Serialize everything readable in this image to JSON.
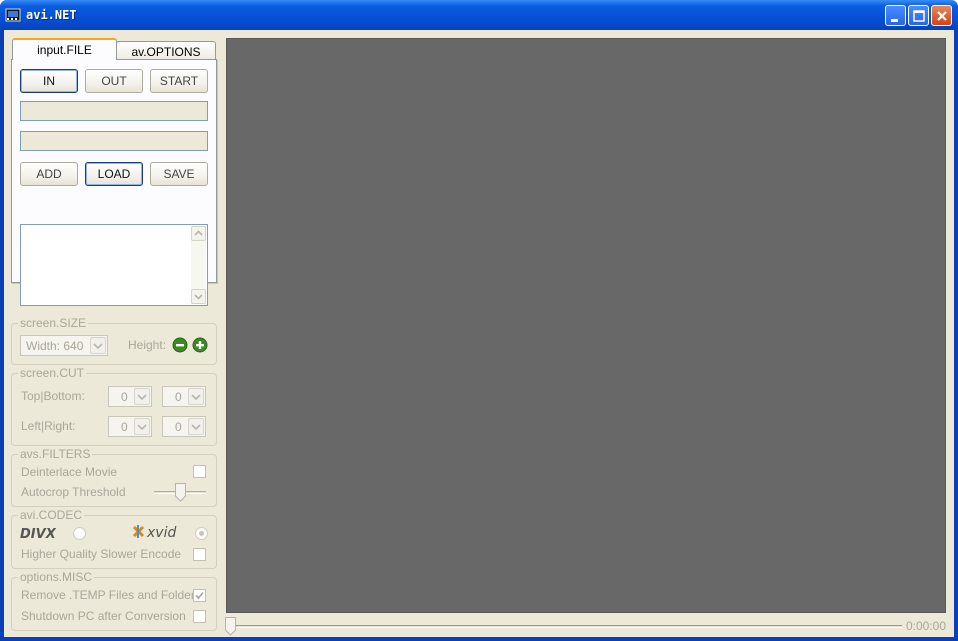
{
  "window": {
    "title": "avi.NET"
  },
  "tabs": [
    {
      "label": "input.FILE",
      "active": true
    },
    {
      "label": "av.OPTIONS",
      "active": false
    }
  ],
  "input_file": {
    "in_label": "IN",
    "out_label": "OUT",
    "start_label": "START",
    "input_path": "",
    "output_path": "",
    "add_label": "ADD",
    "load_label": "LOAD",
    "save_label": "SAVE",
    "queue_items": []
  },
  "screen_size": {
    "title": "screen.SIZE",
    "width_value": "Width: 640",
    "height_label": "Height:"
  },
  "screen_cut": {
    "title": "screen.CUT",
    "topbottom_label": "Top|Bottom:",
    "top_value": "0",
    "bottom_value": "0",
    "leftright_label": "Left|Right:",
    "left_value": "0",
    "right_value": "0"
  },
  "avs_filters": {
    "title": "avs.FILTERS",
    "deinterlace_label": "Deinterlace Movie",
    "deinterlace_checked": false,
    "autocrop_label": "Autocrop Threshold",
    "autocrop_level": 0.5
  },
  "avi_codec": {
    "title": "avi.CODEC",
    "divx_logo": "DIVX",
    "xvid_logo": "xvid",
    "selected": "xvid",
    "hq_label": "Higher Quality Slower Encode",
    "hq_checked": false
  },
  "options_misc": {
    "title": "options.MISC",
    "remove_temp_label": "Remove .TEMP Files and Folder",
    "remove_temp_checked": true,
    "shutdown_label": "Shutdown PC after Conversion",
    "shutdown_checked": false
  },
  "player": {
    "time": "0:00:00",
    "position": 0
  },
  "colors": {
    "titlebar": "#0651d8",
    "face": "#ece9d8",
    "viewer": "#686868",
    "tab_accent": "#f5a623",
    "disabled_text": "#a9a79a"
  }
}
